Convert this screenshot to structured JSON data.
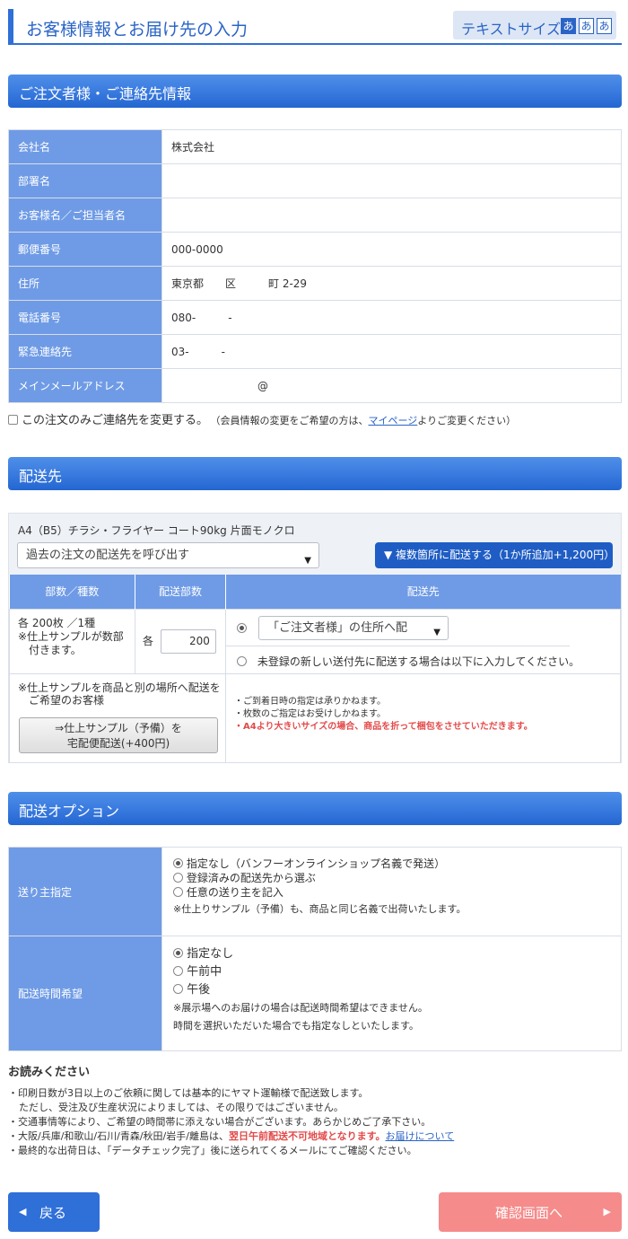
{
  "header": {
    "title": "お客様情報とお届け先の入力",
    "text_size_label": "テキストサイズ",
    "text_size_options": [
      "あ",
      "あ",
      "あ"
    ]
  },
  "orderer": {
    "section_title": "ご注文者様・ご連絡先情報",
    "rows": [
      {
        "label": "会社名",
        "value": "株式会社"
      },
      {
        "label": "部署名",
        "value": ""
      },
      {
        "label": "お客様名／ご担当者名",
        "value": ""
      },
      {
        "label": "郵便番号",
        "value": "000-0000"
      },
      {
        "label": "住所",
        "value": "東京都　　区　　　町 2-29"
      },
      {
        "label": "電話番号",
        "value": "080-　　　-"
      },
      {
        "label": "緊急連絡先",
        "value": "03-　　　-"
      },
      {
        "label": "メインメールアドレス",
        "value": "　　　　　　　　@"
      }
    ],
    "change_contact_label": "この注文のみご連絡先を変更する。",
    "change_contact_note_before": "（会員情報の変更をご希望の方は、",
    "change_contact_link": "マイページ",
    "change_contact_note_after": "よりご変更ください）"
  },
  "shipping": {
    "section_title": "配送先",
    "product": "A4（B5）チラシ・フライヤー コート90kg 片面モノクロ",
    "past_select": "過去の注文の配送先を呼び出す",
    "multi_button": "▼ 複数箇所に配送する（1か所追加+1,200円）",
    "col_kind": "部数／種数",
    "col_qty": "配送部数",
    "col_dest": "配送先",
    "kind_line1": "各  200枚 ／1種",
    "kind_line2": "※仕上サンプルが数部",
    "kind_line3": "付きます。",
    "qty_prefix": "各",
    "qty_value": "200",
    "dest_select": "「ご注文者様」の住所へ配",
    "new_address_label": "未登録の新しい送付先に配送する場合は以下に入力してください。",
    "sample_note1": "※仕上サンプルを商品と別の場所へ配送を",
    "sample_note2": "ご希望のお客様",
    "sample_btn1": "⇒仕上サンプル（予備）を",
    "sample_btn2": "宅配便配送(+400円)",
    "notes": [
      "・ご到着日時の指定は承りかねます。",
      "・枚数のご指定はお受けしかねます。"
    ],
    "warning": "・A4より大きいサイズの場合、商品を折って梱包をさせていただきます。"
  },
  "options": {
    "section_title": "配送オプション",
    "sender_label": "送り主指定",
    "sender_options": [
      "指定なし（バンフーオンラインショップ名義で発送）",
      "登録済みの配送先から選ぶ",
      "任意の送り主を記入"
    ],
    "sender_note": "※仕上りサンプル（予備）も、商品と同じ名義で出荷いたします。",
    "time_label": "配送時間希望",
    "time_options": [
      "指定なし",
      "午前中",
      "午後"
    ],
    "time_note1": "※展示場へのお届けの場合は配送時間希望はできません。",
    "time_note2": "時間を選択いただいた場合でも指定なしといたします。"
  },
  "notice": {
    "heading": "お読みください",
    "line1": "・印刷日数が3日以上のご依頼に関しては基本的にヤマト運輸様で配送致します。",
    "line2": "ただし、受注及び生産状況によりましては、その限りではございません。",
    "line3": "・交通事情等により、ご希望の時間帯に添えない場合がございます。あらかじめご了承下さい。",
    "line4_a": "・大阪/兵庫/和歌山/石川/青森/秋田/岩手/離島は、",
    "line4_b": "翌日午前配送不可地域となります。",
    "line4_link": "お届けについて",
    "line5": "・最終的な出荷日は、「データチェック完了」後に送られてくるメールにてご確認ください。"
  },
  "nav": {
    "back": "戻る",
    "next": "確認画面へ"
  },
  "colors": {
    "accent": "#2f6fd8",
    "header_cell": "#6f9be6",
    "next_button": "#f58b8b",
    "warning": "#e34a4a"
  }
}
